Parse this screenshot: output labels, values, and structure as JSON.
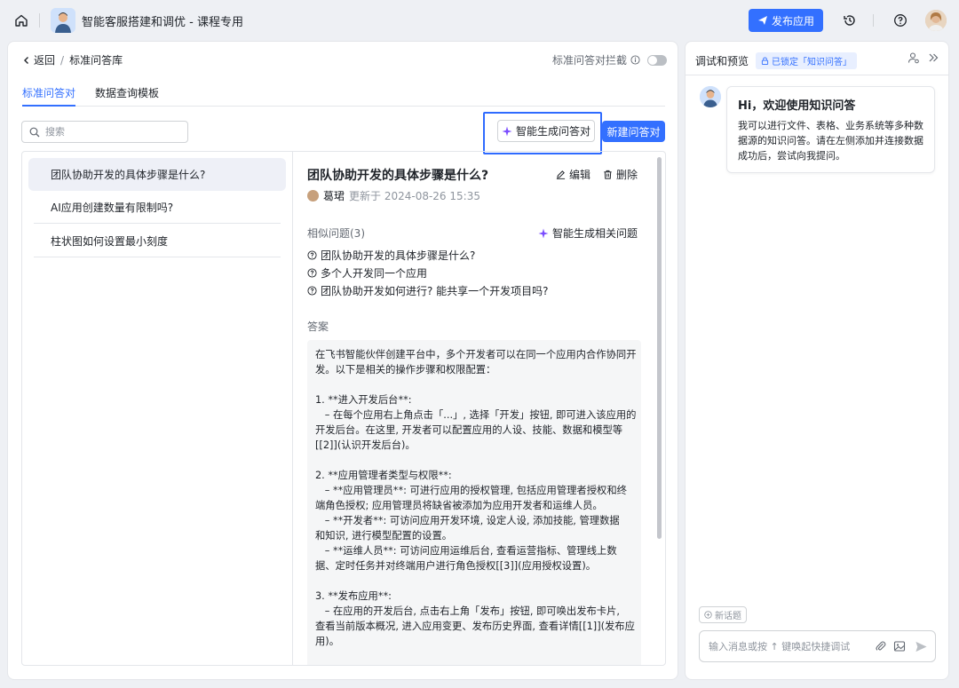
{
  "header": {
    "app_title": "智能客服搭建和调优 - 课程专用",
    "publish_label": "发布应用"
  },
  "breadcrumb": {
    "back_label": "返回",
    "separator": "/",
    "current": "标准问答库"
  },
  "intercept": {
    "label": "标准问答对拦截",
    "enabled": false
  },
  "tabs": [
    {
      "label": "标准问答对",
      "active": true
    },
    {
      "label": "数据查询模板",
      "active": false
    }
  ],
  "search": {
    "placeholder": "搜索",
    "value": ""
  },
  "toolbar": {
    "ai_generate_label": "智能生成问答对",
    "new_label": "新建问答对"
  },
  "qa_list": [
    {
      "question": "团队协助开发的具体步骤是什么?",
      "selected": true
    },
    {
      "question": "AI应用创建数量有限制吗?",
      "selected": false
    },
    {
      "question": "柱状图如何设置最小刻度",
      "selected": false
    }
  ],
  "detail": {
    "title": "团队协助开发的具体步骤是什么?",
    "edit_label": "编辑",
    "delete_label": "删除",
    "author": "葛珺",
    "updated": "更新于 2024-08-26 15:35",
    "similar_label": "相似问题(3)",
    "similar_gen_label": "智能生成相关问题",
    "similar_questions": [
      "团队协助开发的具体步骤是什么?",
      "多个人开发同一个应用",
      "团队协助开发如何进行? 能共享一个开发项目吗?"
    ],
    "answer_label": "答案",
    "answer_lines": [
      "在飞书智能伙伴创建平台中，多个开发者可以在同一个应用内合作协同开",
      "发。以下是相关的操作步骤和权限配置：",
      "",
      "1. **进入开发后台**:",
      "   – 在每个应用右上角点击「...」, 选择「开发」按钮, 即可进入该应用的",
      "开发后台。在这里, 开发者可以配置应用的人设、技能、数据和模型等",
      "[[2]](认识开发后台)。",
      "",
      "2. **应用管理者类型与权限**:",
      "   – **应用管理员**: 可进行应用的授权管理, 包括应用管理者授权和终",
      "端角色授权; 应用管理员将缺省被添加为应用开发者和运维人员。",
      "   – **开发者**: 可访问应用开发环境, 设定人设, 添加技能, 管理数据",
      "和知识, 进行模型配置的设置。",
      "   – **运维人员**: 可访问应用运维后台, 查看运营指标、管理线上数",
      "据、定时任务并对终端用户进行角色授权[[3]](应用授权设置)。",
      "",
      "3. **发布应用**:",
      "   – 在应用的开发后台, 点击右上角「发布」按钮, 即可唤出发布卡片,",
      "查看当前版本概况, 进入应用变更、发布历史界面, 查看详情[[1]](发布应",
      "用)。"
    ]
  },
  "preview": {
    "title": "调试和预览",
    "locked_tag": "已锁定「知识问答」",
    "welcome_title": "Hi，欢迎使用知识问答",
    "welcome_lines": [
      "我可以进行文件、表格、业务系统等多种数",
      "据源的知识问答。请在左侧添加并连接数据",
      "成功后，尝试向我提问。"
    ],
    "new_topic_label": "新话题",
    "input_placeholder": "输入消息或按 ↑ 键唤起快捷调试"
  },
  "colors": {
    "accent": "#3370ff",
    "highlight": "#2f6bff",
    "selected_bg": "#eef0f7"
  },
  "icons": [
    "home-icon",
    "send-icon",
    "history-icon",
    "help-icon",
    "search-icon",
    "sparkle-icon",
    "edit-icon",
    "trash-icon",
    "question-circle-icon",
    "lock-icon",
    "user-settings-icon",
    "collapse-right-icon",
    "attach-icon",
    "image-icon"
  ]
}
